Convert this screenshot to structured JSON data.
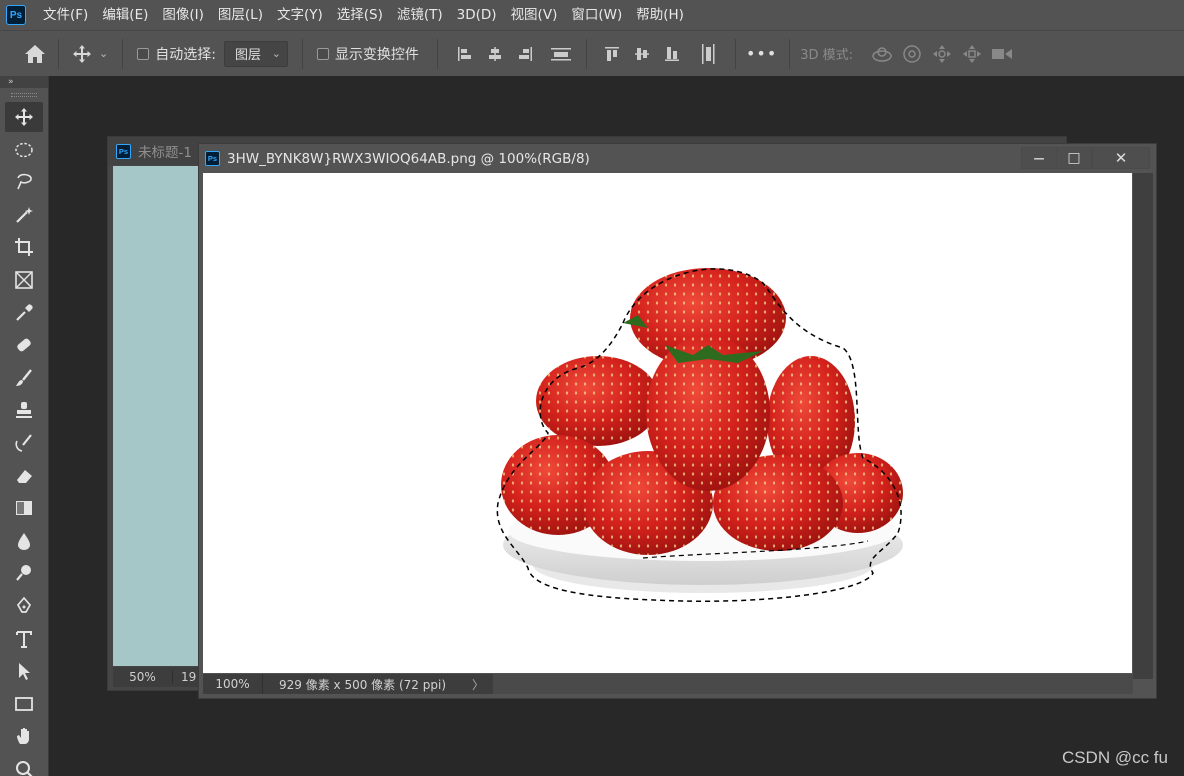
{
  "app": {
    "logo": "Ps"
  },
  "menu": [
    "文件(F)",
    "编辑(E)",
    "图像(I)",
    "图层(L)",
    "文字(Y)",
    "选择(S)",
    "滤镜(T)",
    "3D(D)",
    "视图(V)",
    "窗口(W)",
    "帮助(H)"
  ],
  "options": {
    "auto_select_label": "自动选择:",
    "auto_select_value": "图层",
    "show_transform_label": "显示变换控件",
    "more_label": "•••",
    "mode3d_label": "3D 模式:"
  },
  "toolbar": {
    "collapse_label": "»",
    "tools": [
      "move-tool",
      "marquee-tool",
      "lasso-tool",
      "magic-wand-tool",
      "crop-tool",
      "frame-tool",
      "eyedropper-tool",
      "healing-brush-tool",
      "brush-tool",
      "clone-stamp-tool",
      "history-brush-tool",
      "eraser-tool",
      "gradient-tool",
      "blur-tool",
      "dodge-tool",
      "pen-tool",
      "type-tool",
      "path-selection-tool",
      "rectangle-tool",
      "hand-tool",
      "zoom-tool"
    ]
  },
  "doc_back": {
    "title": "未标题-1",
    "zoom": "50%",
    "status_partial": "19"
  },
  "doc_front": {
    "title": "3HW_BYNK8W}RWX3WIOQ64AB.png @ 100%(RGB/8)",
    "zoom": "100%",
    "dimensions": "929 像素 x 500 像素 (72 ppi)",
    "status_arrow": "〉",
    "minimize": "—",
    "maximize": "□",
    "close": "✕"
  },
  "watermark": "CSDN @cc fu",
  "colors": {
    "chrome": "#535353",
    "workspace": "#282828",
    "back_canvas": "#a6c7c8",
    "strawberry": "#d3211c",
    "accent": "#31a8ff"
  }
}
